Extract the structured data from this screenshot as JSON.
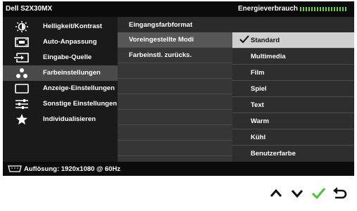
{
  "header": {
    "model": "Dell S2X30MX",
    "energy_label": "Energieverbrauch",
    "energy_level": 0.95
  },
  "sidebar": {
    "items": [
      {
        "label": "Helligkeit/Kontrast",
        "icon": "brightness-icon",
        "active": false
      },
      {
        "label": "Auto-Anpassung",
        "icon": "auto-adjust-icon",
        "active": false
      },
      {
        "label": "Eingabe-Quelle",
        "icon": "input-source-icon",
        "active": false
      },
      {
        "label": "Farbeinstellungen",
        "icon": "color-settings-icon",
        "active": true
      },
      {
        "label": "Anzeige-Einstellungen",
        "icon": "display-settings-icon",
        "active": false
      },
      {
        "label": "Sonstige Einstellungen",
        "icon": "other-settings-icon",
        "active": false
      },
      {
        "label": "Individualisieren",
        "icon": "star-icon",
        "active": false
      }
    ]
  },
  "middle": {
    "title": "Eingangsfarbformat",
    "items": [
      {
        "label": "Voreingestellte Modi",
        "selected": true
      },
      {
        "label": "Farbeinstl. zurücks.",
        "selected": false
      }
    ]
  },
  "options": {
    "items": [
      {
        "label": "Standard",
        "selected": true
      },
      {
        "label": "Multimedia",
        "selected": false
      },
      {
        "label": "Film",
        "selected": false
      },
      {
        "label": "Spiel",
        "selected": false
      },
      {
        "label": "Text",
        "selected": false
      },
      {
        "label": "Warm",
        "selected": false
      },
      {
        "label": "Kühl",
        "selected": false
      },
      {
        "label": "Benutzerfarbe",
        "selected": false
      }
    ]
  },
  "footer": {
    "resolution": "Auflösung: 1920x1080 @ 60Hz"
  },
  "buttons": [
    {
      "icon": "up-arrow-icon"
    },
    {
      "icon": "down-arrow-icon"
    },
    {
      "icon": "checkmark-icon"
    },
    {
      "icon": "back-icon"
    }
  ],
  "colors": {
    "accent_green": "#4cc03a",
    "panel_dark": "#1a1a1a",
    "selected_light": "#cfcfcf"
  }
}
